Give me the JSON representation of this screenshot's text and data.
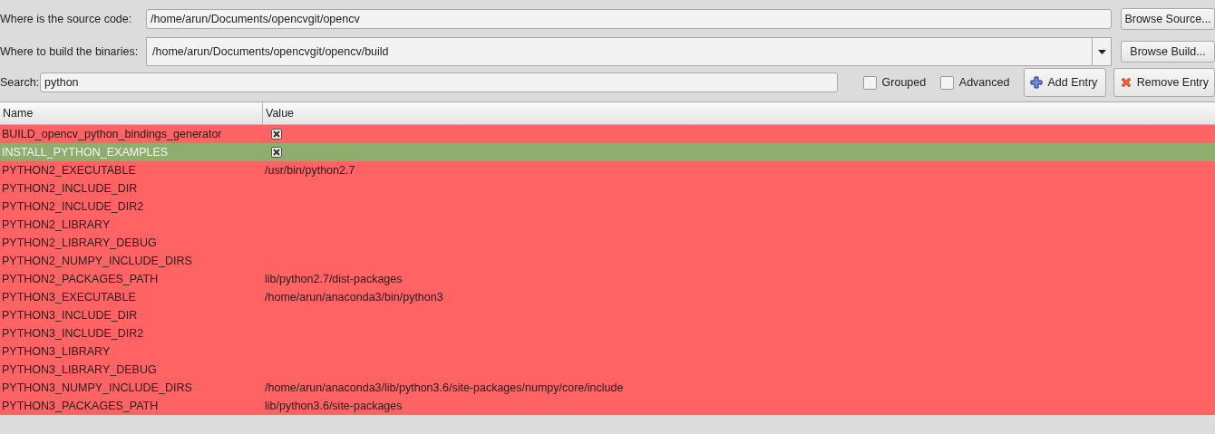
{
  "source": {
    "label": "Where is the source code:",
    "value": "/home/arun/Documents/opencvgit/opencv",
    "button": "Browse Source..."
  },
  "build": {
    "label": "Where to build the binaries:",
    "value": "/home/arun/Documents/opencvgit/opencv/build",
    "button": "Browse Build..."
  },
  "search": {
    "label": "Search:",
    "value": "python"
  },
  "options": [
    {
      "label": "Grouped",
      "checked": false
    },
    {
      "label": "Advanced",
      "checked": false
    }
  ],
  "add_button": "Add Entry",
  "remove_button": "Remove Entry",
  "table": {
    "columns": [
      "Name",
      "Value"
    ],
    "rows": [
      {
        "name": "BUILD_opencv_python_bindings_generator",
        "kind": "checkbox",
        "checked": true,
        "selected": false
      },
      {
        "name": "INSTALL_PYTHON_EXAMPLES",
        "kind": "checkbox",
        "checked": true,
        "selected": true
      },
      {
        "name": "PYTHON2_EXECUTABLE",
        "kind": "text",
        "value": "/usr/bin/python2.7",
        "selected": false
      },
      {
        "name": "PYTHON2_INCLUDE_DIR",
        "kind": "text",
        "selected": false
      },
      {
        "name": "PYTHON2_INCLUDE_DIR2",
        "kind": "text",
        "selected": false
      },
      {
        "name": "PYTHON2_LIBRARY",
        "kind": "text",
        "selected": false
      },
      {
        "name": "PYTHON2_LIBRARY_DEBUG",
        "kind": "text",
        "selected": false
      },
      {
        "name": "PYTHON2_NUMPY_INCLUDE_DIRS",
        "kind": "text",
        "selected": false
      },
      {
        "name": "PYTHON2_PACKAGES_PATH",
        "kind": "text",
        "value": "lib/python2.7/dist-packages",
        "selected": false
      },
      {
        "name": "PYTHON3_EXECUTABLE",
        "kind": "text",
        "value": "/home/arun/anaconda3/bin/python3",
        "selected": false
      },
      {
        "name": "PYTHON3_INCLUDE_DIR",
        "kind": "text",
        "selected": false
      },
      {
        "name": "PYTHON3_INCLUDE_DIR2",
        "kind": "text",
        "selected": false
      },
      {
        "name": "PYTHON3_LIBRARY",
        "kind": "text",
        "selected": false
      },
      {
        "name": "PYTHON3_LIBRARY_DEBUG",
        "kind": "text",
        "selected": false
      },
      {
        "name": "PYTHON3_NUMPY_INCLUDE_DIRS",
        "kind": "text",
        "value": "/home/arun/anaconda3/lib/python3.6/site-packages/numpy/core/include",
        "selected": false
      },
      {
        "name": "PYTHON3_PACKAGES_PATH",
        "kind": "text",
        "value": "lib/python3.6/site-packages",
        "selected": false
      }
    ]
  }
}
